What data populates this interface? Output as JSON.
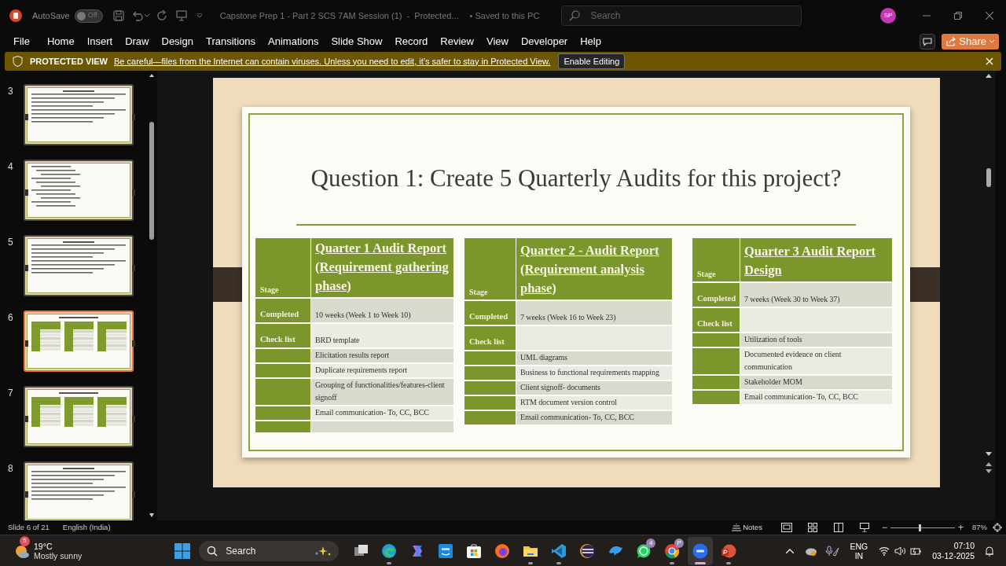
{
  "title_bar": {
    "autosave_label": "AutoSave",
    "autosave": {
      "on": false,
      "label": "Off"
    },
    "document_title": "Capstone Prep 1 - Part 2 SCS 7AM Session (1)  -  Protected...",
    "save_status": "• Saved to this PC",
    "search_placeholder": "Search",
    "avatar": "SP"
  },
  "menu": [
    {
      "label": "File"
    },
    {
      "label": "Home"
    },
    {
      "label": "Insert"
    },
    {
      "label": "Draw"
    },
    {
      "label": "Design"
    },
    {
      "label": "Transitions"
    },
    {
      "label": "Animations"
    },
    {
      "label": "Slide Show"
    },
    {
      "label": "Record"
    },
    {
      "label": "Review"
    },
    {
      "label": "View"
    },
    {
      "label": "Developer"
    },
    {
      "label": "Help"
    }
  ],
  "share_button": "Share",
  "protected_bar": {
    "label": "PROTECTED VIEW",
    "message": "Be careful—files from the Internet can contain viruses. Unless you need to edit, it’s safer to stay in Protected View.",
    "button": "Enable Editing"
  },
  "thumbnails": [
    {
      "number": "3",
      "selected": false,
      "kind": "text"
    },
    {
      "number": "4",
      "selected": false,
      "kind": "list"
    },
    {
      "number": "5",
      "selected": false,
      "kind": "text"
    },
    {
      "number": "6",
      "selected": true,
      "kind": "tables"
    },
    {
      "number": "7",
      "selected": false,
      "kind": "tables"
    },
    {
      "number": "8",
      "selected": false,
      "kind": "text"
    }
  ],
  "slide": {
    "title": "Question 1: Create 5 Quarterly Audits for this project?",
    "tables": [
      {
        "stage_label": "Stage",
        "heading": "Quarter 1 Audit Report (Requirement gathering phase)",
        "rows": [
          {
            "label": "Completed",
            "value": "10 weeks (Week 1 to Week 10)"
          },
          {
            "label": "Check list",
            "value": "BRD template"
          },
          {
            "value": "Elicitation results report"
          },
          {
            "value": "Duplicate requirements report"
          },
          {
            "value": "Grouping of functionalities/features-client signoff"
          },
          {
            "value": "Email communication- To, CC, BCC"
          },
          {}
        ]
      },
      {
        "stage_label": "Stage",
        "heading": "Quarter 2 - Audit Report (Requirement analysis phase)",
        "rows": [
          {
            "label": "Completed",
            "value": "7 weeks (Week 16 to Week 23)"
          },
          {
            "label": "Check list"
          },
          {
            "value": "UML diagrams"
          },
          {
            "value": "Business to functional requirements mapping"
          },
          {
            "value": "Client signoff- documents"
          },
          {
            "value": "RTM document version control"
          },
          {
            "value": "Email communication- To, CC, BCC"
          }
        ]
      },
      {
        "stage_label": "Stage",
        "heading": "Quarter 3 Audit Report Design",
        "rows": [
          {
            "label": "Completed",
            "value": "7 weeks (Week 30 to Week 37)"
          },
          {
            "label": "Check list"
          },
          {
            "value": "Utilization of tools"
          },
          {
            "value": "Documented evidence on client communication"
          },
          {
            "value": "Stakeholder MOM"
          },
          {
            "value": "Email communication- To, CC, BCC"
          }
        ]
      }
    ]
  },
  "status_bar": {
    "slide_position": "Slide 6 of 21",
    "language": "English (India)",
    "notes": "Notes",
    "zoom": {
      "zoom_out": "−",
      "level": 0.45,
      "zoom_in": "+",
      "reading": "87%"
    }
  },
  "taskbar": {
    "weather": {
      "badge": "5",
      "temperature": "19°C",
      "condition": "Mostly sunny"
    },
    "search_placeholder": "Search",
    "apps": [
      {
        "kind": "taskview",
        "running": false,
        "active": false
      },
      {
        "kind": "edge",
        "running": true,
        "active": false
      },
      {
        "kind": "copilot",
        "running": false,
        "active": false
      },
      {
        "kind": "prime",
        "running": false,
        "active": false
      },
      {
        "kind": "store",
        "running": false,
        "active": false
      },
      {
        "kind": "firefox",
        "running": false,
        "active": false
      },
      {
        "kind": "folder",
        "running": true,
        "active": false
      },
      {
        "kind": "vscode",
        "running": true,
        "active": false
      },
      {
        "kind": "eclipse",
        "running": false,
        "active": false
      },
      {
        "kind": "dolphin",
        "running": false,
        "active": false
      },
      {
        "kind": "whatsapp",
        "running": false,
        "active": false,
        "badge": "4"
      },
      {
        "kind": "chrome",
        "running": true,
        "active": false,
        "badge": "P"
      },
      {
        "kind": "zoom",
        "running": true,
        "active": true
      },
      {
        "kind": "powerpoint",
        "running": true,
        "active": false
      }
    ],
    "tray": {
      "language": "ENG",
      "region": "IN",
      "time": "07:10",
      "date": "03-12-2025"
    }
  }
}
